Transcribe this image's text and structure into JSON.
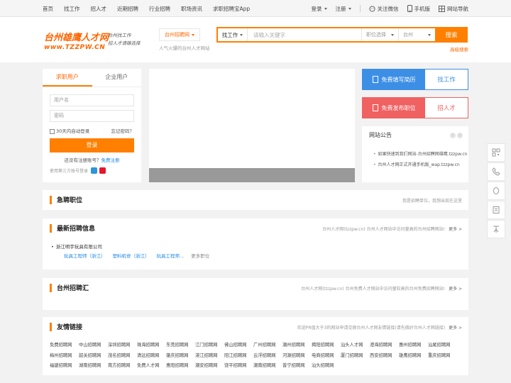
{
  "topnav": [
    "首页",
    "找工作",
    "招人才",
    "近期招聘",
    "行业招聘",
    "职场资讯",
    "求职招聘宝App"
  ],
  "topright": {
    "login": "登录",
    "register": "注册",
    "wechat": "关注微信",
    "mobile": "手机版",
    "sitenav": "网站导航"
  },
  "header": {
    "logo_line1": "台州雄鹰人才网",
    "logo_line2": "www.TZZPW.CN",
    "slogan1": "台州找工作",
    "slogan2": "招人才请雄选择",
    "city": "台州招聘网",
    "city_sub": "人气火爆的台州人才网站"
  },
  "search": {
    "type": "找工作",
    "placeholder": "请输入关键字",
    "position": "职位选择",
    "city": "台州",
    "button": "搜索",
    "advanced": "高级搜索"
  },
  "login": {
    "tab_seeker": "求职用户",
    "tab_company": "企业用户",
    "username": "用户名",
    "password": "密码",
    "remember": "30天内自动登录",
    "forgot": "忘记密码？",
    "button": "登录",
    "no_account": "还没有注册账号？",
    "register_link": "免费注册",
    "third": "使用第三方账号登录"
  },
  "right_buttons": {
    "resume": "免费填写简历",
    "find_job": "找工作",
    "post_job": "免费发布职位",
    "hire": "招人才"
  },
  "notice": {
    "title": "网站公告",
    "items": [
      "如果快速到我们网站-台州招聘网雄鹰.tzzpw.cn",
      "台州人才网正式开通手机版_wap.tzzpw.cn"
    ]
  },
  "urgent": {
    "title": "急聘职位",
    "right": "我是招聘单位，我想出现在这里"
  },
  "latest": {
    "title": "最新招聘信息",
    "right": "台州人才网(tzzpw.cn) 台州人才网站中访问量高的台州招聘网站!",
    "more": "更多 >",
    "company": "浙江明宇玩具有限公司",
    "jobs": [
      "玩具工程师（浙江）",
      "塑料机修（浙江）",
      "玩具工程师...",
      "更多职位"
    ]
  },
  "fair": {
    "title": "台州招聘汇",
    "right": "台州人才网(tzzpw.cn) 台州免费人才网站中访问量较高的台州免费招聘网站!",
    "more": "更多 >"
  },
  "friends": {
    "title": "友情链接",
    "right": "欢迎PR值大于3的网站申请交换台州人才网友情链接(请先做好台州人才网链接)",
    "more": "更多 >",
    "links": [
      "免费招聘网",
      "中山招聘网",
      "深圳招聘网",
      "珠海招聘网",
      "东莞招聘网",
      "江门招聘网",
      "佛山招聘网",
      "广州招聘网",
      "潮州招聘网",
      "揭阳招聘网",
      "汕头人才网",
      "澄海招聘网",
      "惠州招聘网",
      "汕尾招聘网",
      "梅州招聘网",
      "韶关招聘网",
      "茂名招聘网",
      "清远招聘网",
      "肇庆招聘网",
      "湛江招聘网",
      "阳江招聘网",
      "云浮招聘网",
      "河源招聘网",
      "电商招聘网",
      "厦门招聘网",
      "西安招聘网",
      "雄鹰招聘网",
      "重庆招聘网",
      "福建招聘网",
      "湖南招聘网",
      "南方招聘网",
      "免费人才网",
      "惠阳招聘网",
      "潮安招聘网",
      "饶平招聘网",
      "潮南招聘网",
      "普宁招聘网",
      "汕头招聘网"
    ]
  },
  "colors": {
    "accent": "#ff7f00",
    "blue": "#3d8fe6",
    "red": "#f06161"
  },
  "float_icons": [
    "qrcode-icon",
    "phone-icon",
    "qq-icon",
    "feedback-icon",
    "back-to-top-icon"
  ]
}
